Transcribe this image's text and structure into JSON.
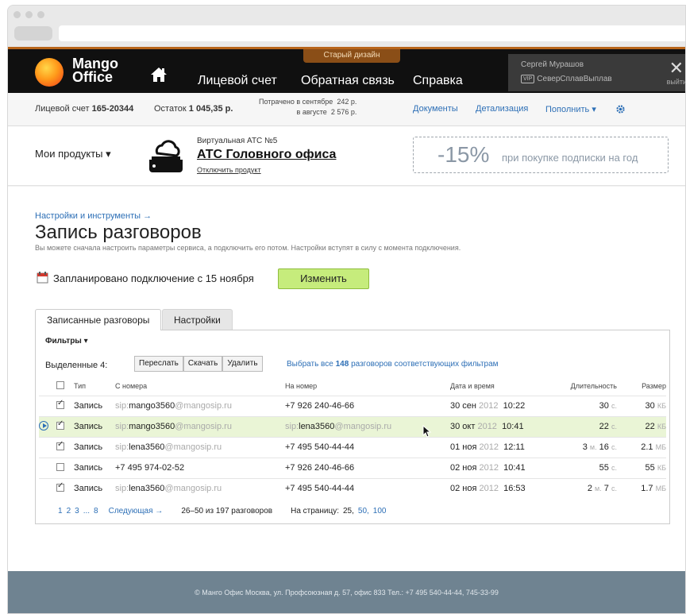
{
  "header": {
    "logo_line1": "Mango",
    "logo_line2": "Office",
    "old_design": "Старый дизайн",
    "nav": [
      "Лицевой счет",
      "Обратная связь",
      "Справка"
    ],
    "user_name": "Сергей Мурашов",
    "vip_badge": "VIP",
    "company": "СеверСплавВыплав",
    "exit": "выйти",
    "close": "✕"
  },
  "account": {
    "account_label": "Лицевой счет",
    "account_number": "165-20344",
    "balance_label": "Остаток",
    "balance": "1 045,35 р.",
    "spent_label": "Потрачено в сентябре",
    "spent_sep": "242 р.",
    "spent_aug_label": "в августе",
    "spent_aug": "2 576 р.",
    "documents": "Документы",
    "details": "Детализация",
    "topup": "Пополнить ▾",
    "colors": {
      "link": "#2d6fb6"
    }
  },
  "products": {
    "menu": "Мои продукты ▾",
    "subtitle": "Виртуальная АТС №5",
    "title": "АТС Головного офиса",
    "disable": "Отключить продукт",
    "promo_percent": "-15%",
    "promo_text": "при покупке подписки на год"
  },
  "main": {
    "breadcrumb": "Настройки и инструменты →",
    "title": "Запись разговоров",
    "description": "Вы можете сначала настроить параметры сервиса, а подключить его потом. Настройки вступят в силу с момента подключения.",
    "scheduled": "Запланировано подключение с 15 ноября",
    "change_button": "Изменить",
    "tabs": [
      "Записанные разговоры",
      "Настройки"
    ],
    "filters": "Фильтры ▾",
    "selected": "Выделенные 4:",
    "actions": [
      "Переслать",
      "Скачать",
      "Удалить"
    ],
    "select_all_prefix": "Выбрать все",
    "select_all_count": "148",
    "select_all_suffix": "разговоров соответствующих фильтрам",
    "columns": [
      "Тип",
      "С номера",
      "На номер",
      "Дата и время",
      "Длительность",
      "Размер"
    ],
    "rows": [
      {
        "type": "Запись",
        "from_user": "sip:",
        "from_main": "mango3560",
        "from_domain": "@mangosip.ru",
        "to": "+7 926 240-46-66",
        "date": "30 сен",
        "year": "2012",
        "time": "10:22",
        "dur_a": "",
        "dur_a_unit": "",
        "dur_b": "30",
        "dur_b_unit": "с.",
        "size": "30",
        "size_unit": "КБ"
      },
      {
        "type": "Запись",
        "from_user": "sip:",
        "from_main": "mango3560",
        "from_domain": "@mangosip.ru",
        "to": "sip:lena3560@mangosip.ru",
        "to_prefix": "sip:",
        "to_main": "lena3560",
        "to_domain": "@mangosip.ru",
        "date": "30 окт",
        "year": "2012",
        "time": "10:41",
        "dur_a": "",
        "dur_a_unit": "",
        "dur_b": "22",
        "dur_b_unit": "с.",
        "size": "22",
        "size_unit": "КБ"
      },
      {
        "type": "Запись",
        "from_user": "sip:",
        "from_main": "lena3560",
        "from_domain": "@mangosip.ru",
        "to": "+7 495 540-44-44",
        "date": "01 ноя",
        "year": "2012",
        "time": "12:11",
        "dur_a": "3",
        "dur_a_unit": "м.",
        "dur_b": "16",
        "dur_b_unit": "с.",
        "size": "2.1",
        "size_unit": "МБ"
      },
      {
        "type": "Запись",
        "from_user": "",
        "from_main": "+7 495 974-02-52",
        "from_domain": "",
        "to": "+7 926 240-46-66",
        "date": "02 ноя",
        "year": "2012",
        "time": "10:41",
        "dur_a": "",
        "dur_a_unit": "",
        "dur_b": "55",
        "dur_b_unit": "с.",
        "size": "55",
        "size_unit": "КБ"
      },
      {
        "type": "Запись",
        "from_user": "sip:",
        "from_main": "lena3560",
        "from_domain": "@mangosip.ru",
        "to": "+7 495 540-44-44",
        "date": "02 ноя",
        "year": "2012",
        "time": "16:53",
        "dur_a": "2",
        "dur_a_unit": "м.",
        "dur_b": "7",
        "dur_b_unit": "с.",
        "size": "1.7",
        "size_unit": "МБ"
      }
    ],
    "pager": {
      "pages": [
        "1",
        "2",
        "3",
        "...",
        "8"
      ],
      "next": "Следующая →",
      "range": "26–50 из 197 разговоров",
      "per_page_label": "На страницу:",
      "per_page": [
        "25,",
        "50,",
        "100"
      ]
    }
  },
  "footer": {
    "text": "© Манго Офис   Москва, ул. Профсоюзная д. 57, офис 833   Тел.: +7 495 540-44-44, 745-33-99"
  }
}
